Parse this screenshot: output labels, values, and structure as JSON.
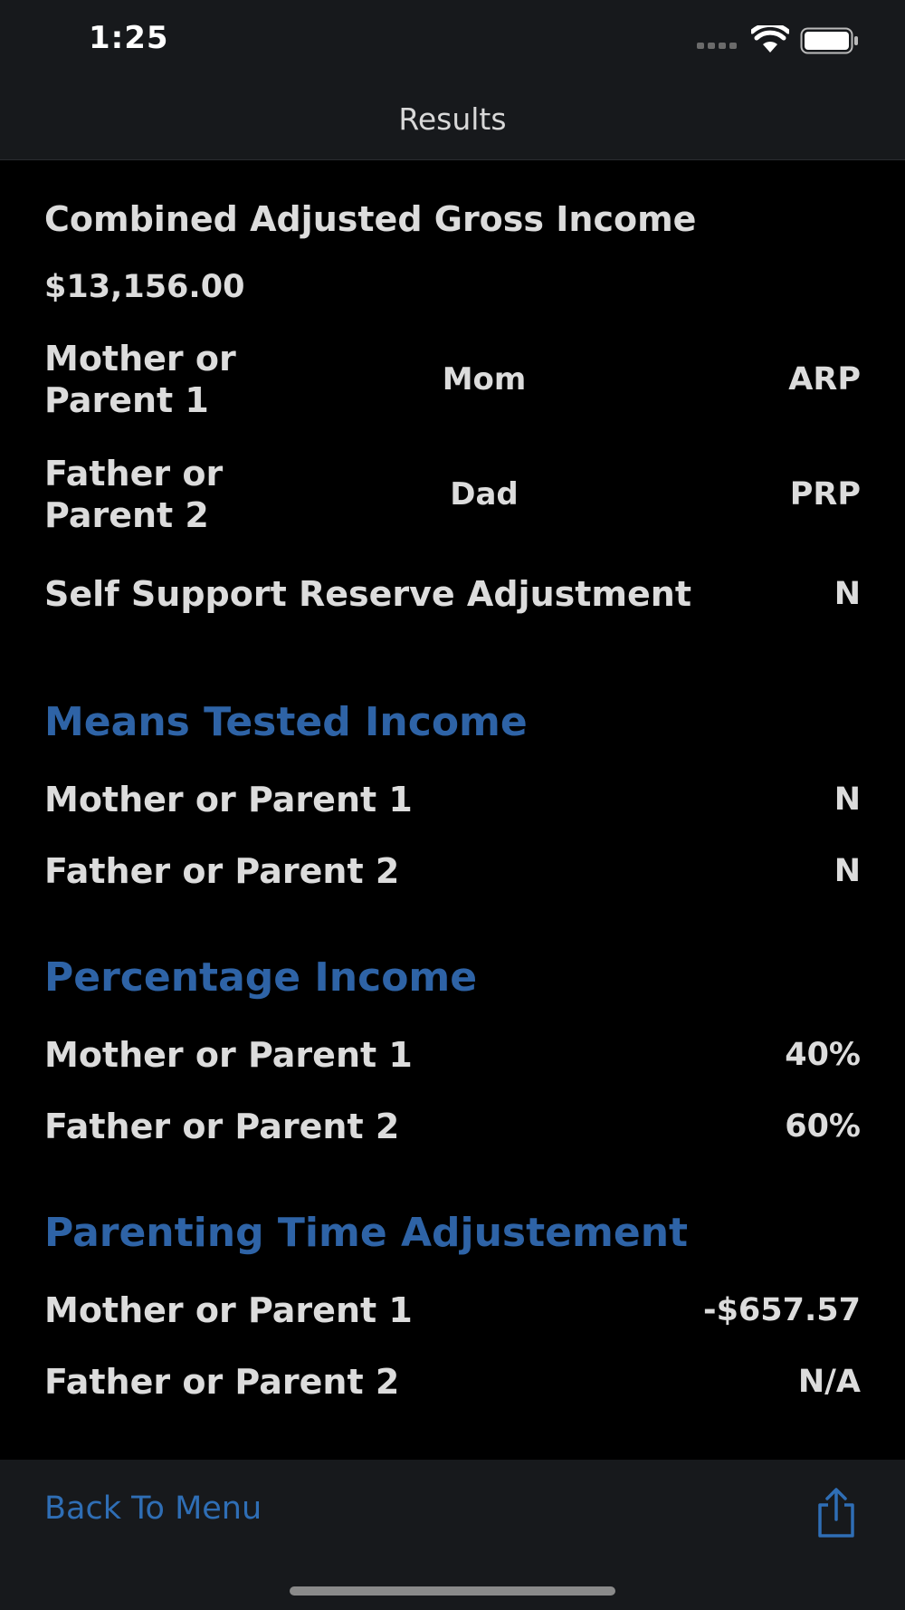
{
  "status_bar": {
    "time": "1:25"
  },
  "nav": {
    "title": "Results"
  },
  "combined": {
    "label": "Combined Adjusted Gross Income",
    "amount": "$13,156.00"
  },
  "parents": [
    {
      "label": "Mother or Parent 1",
      "name": "Mom",
      "role": "ARP"
    },
    {
      "label": "Father or Parent 2",
      "name": "Dad",
      "role": "PRP"
    }
  ],
  "self_support": {
    "label": "Self Support Reserve Adjustment",
    "value": "N"
  },
  "means_tested": {
    "title": "Means Tested Income",
    "rows": [
      {
        "label": "Mother or Parent 1",
        "value": "N"
      },
      {
        "label": "Father or Parent 2",
        "value": "N"
      }
    ]
  },
  "percentage": {
    "title": "Percentage Income",
    "rows": [
      {
        "label": "Mother or Parent 1",
        "value": "40%"
      },
      {
        "label": "Father or Parent 2",
        "value": "60%"
      }
    ]
  },
  "parenting_time": {
    "title": "Parenting Time Adjustement",
    "rows": [
      {
        "label": "Mother or Parent 1",
        "value": "-$657.57"
      },
      {
        "label": "Father or Parent 2",
        "value": "N/A"
      }
    ]
  },
  "toolbar": {
    "back_label": "Back To Menu"
  },
  "icons": {
    "share": "share-icon",
    "wifi": "wifi-icon",
    "battery": "battery-icon",
    "signal": "cellular-signal-icon"
  },
  "colors": {
    "accent": "#2f6eb5",
    "section_title": "#2e63a6",
    "background": "#000000",
    "bar": "#17191c"
  }
}
